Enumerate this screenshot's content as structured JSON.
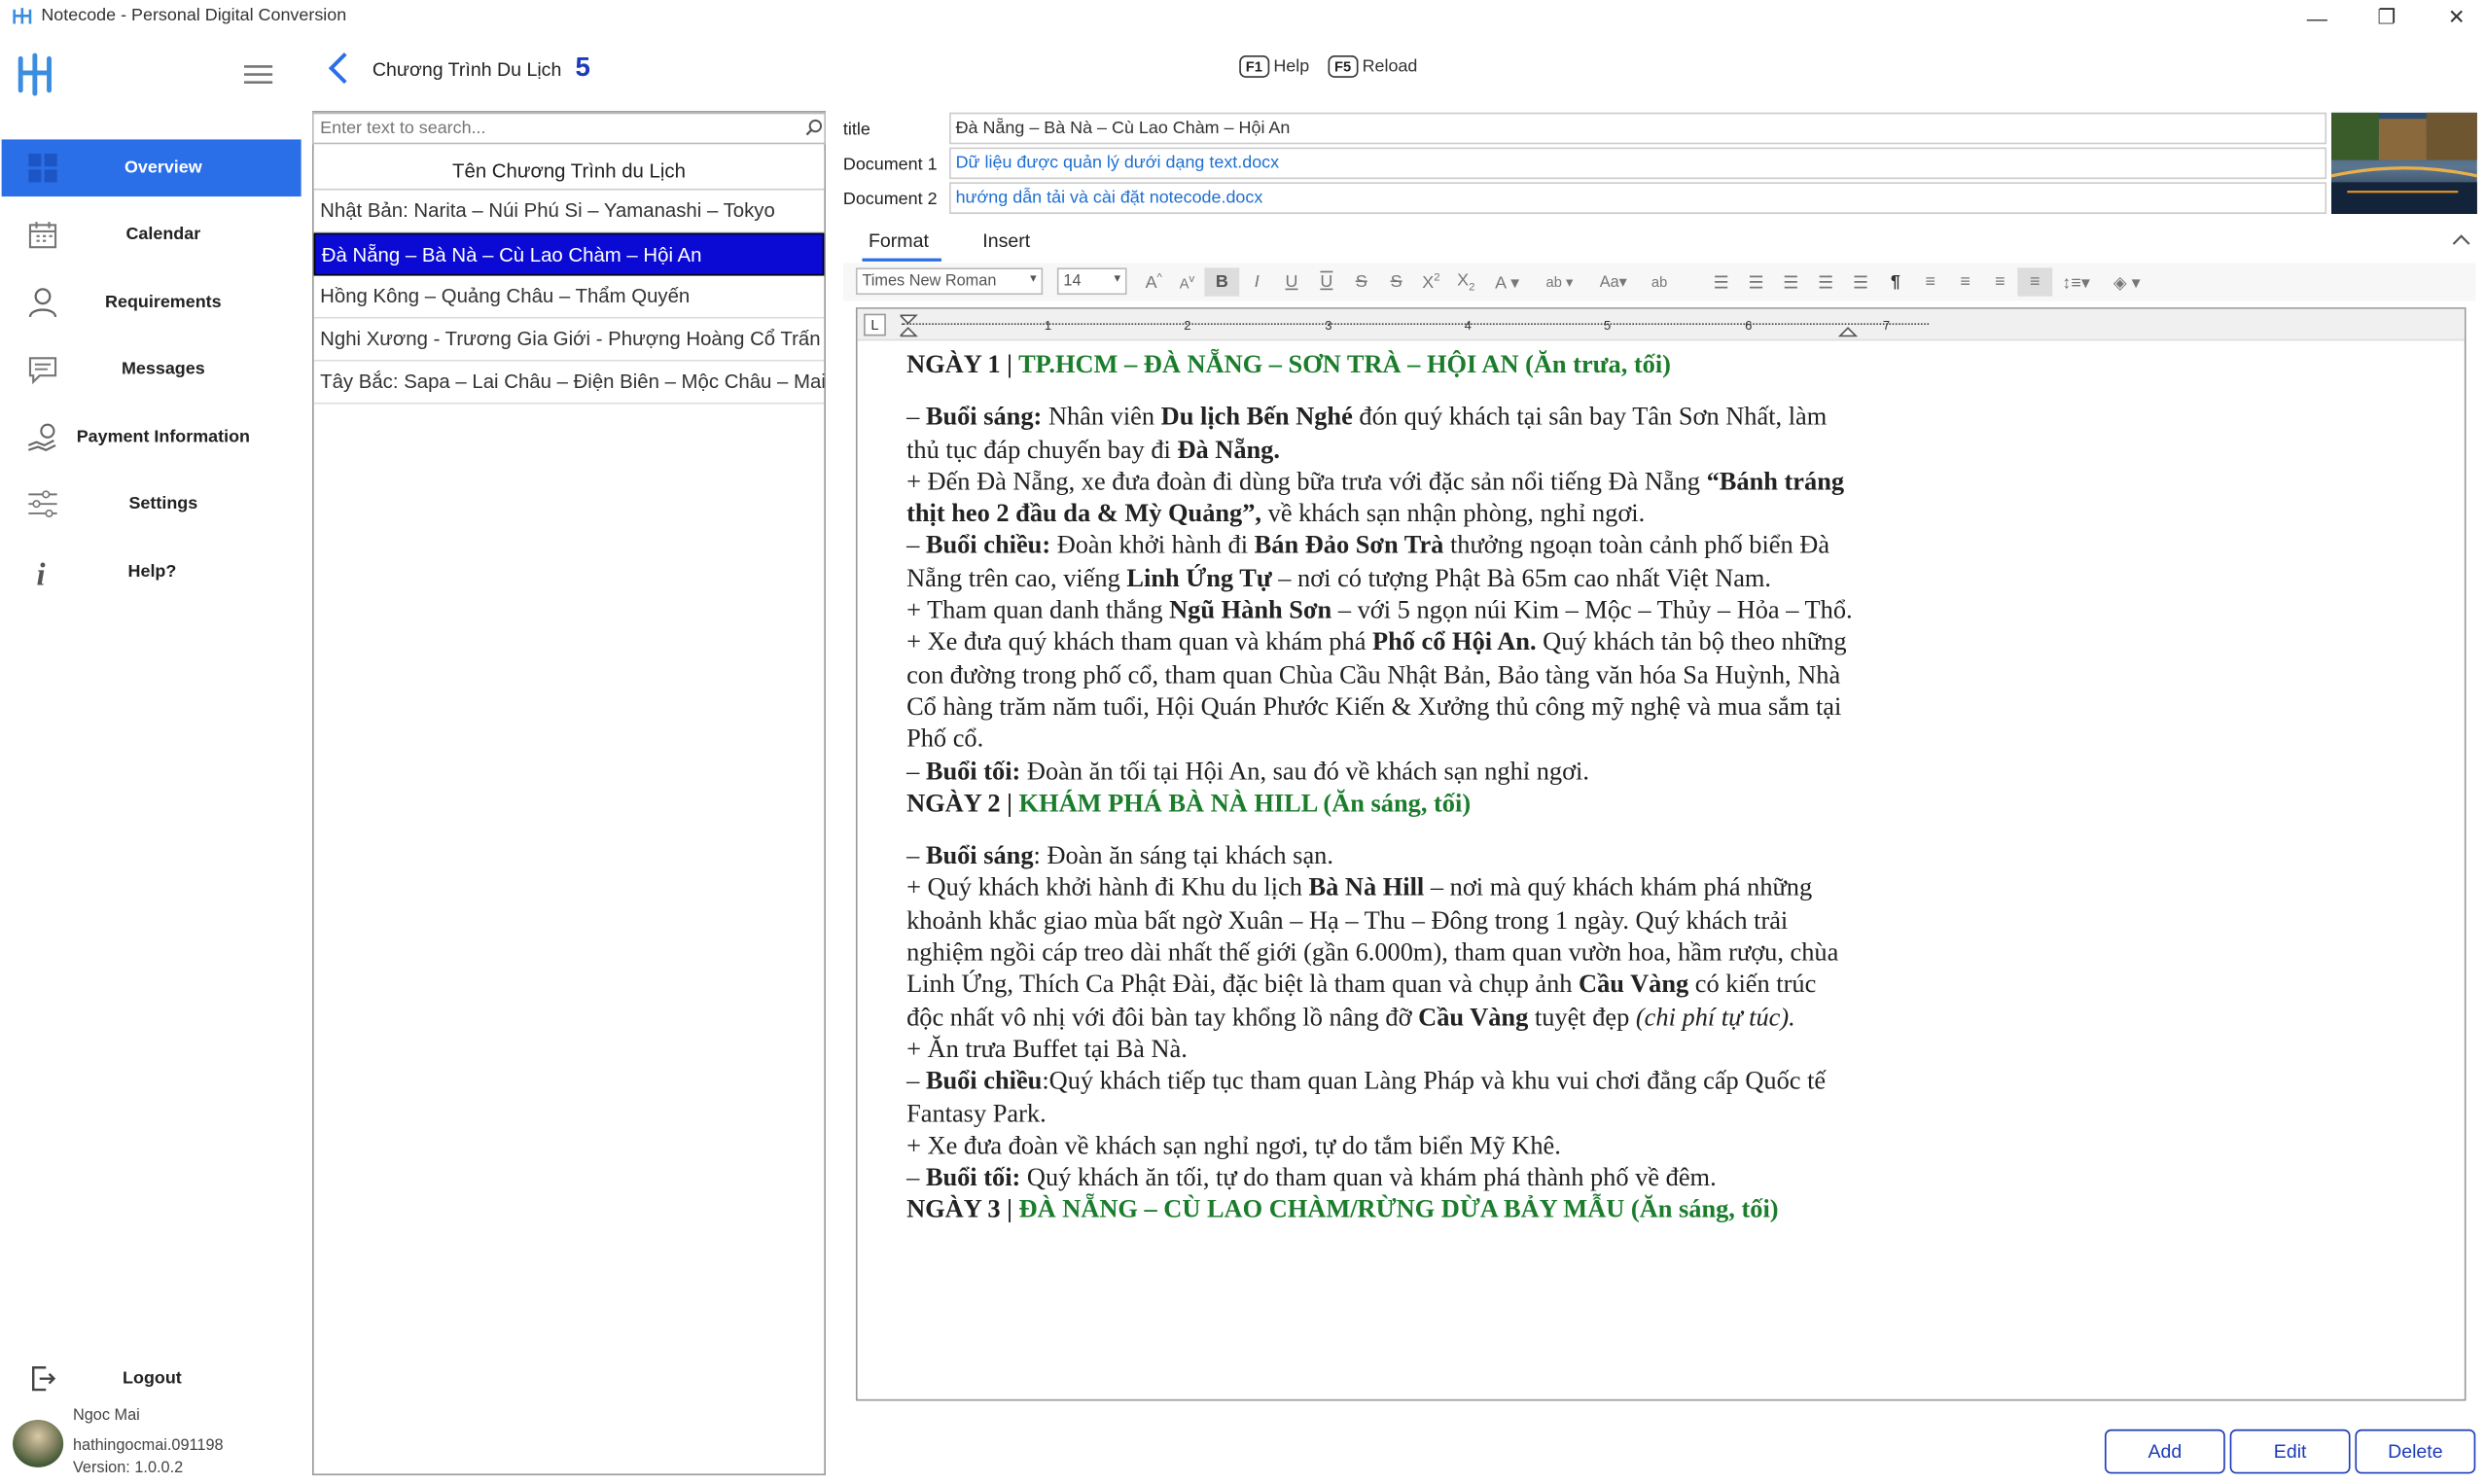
{
  "window": {
    "title": "Notecode - Personal Digital Conversion",
    "minimize": "—",
    "maximize": "❐",
    "close": "✕"
  },
  "sidebar": {
    "items": [
      {
        "label": "Overview",
        "icon": "overview-icon",
        "active": true
      },
      {
        "label": "Calendar",
        "icon": "calendar-icon"
      },
      {
        "label": "Requirements",
        "icon": "user-icon"
      },
      {
        "label": "Messages",
        "icon": "message-icon"
      },
      {
        "label": "Payment Information",
        "icon": "payment-icon"
      },
      {
        "label": "Settings",
        "icon": "sliders-icon"
      },
      {
        "label": "Help?",
        "icon": "info-icon"
      }
    ],
    "logout_label": "Logout",
    "user_name": "Ngoc Mai",
    "user_handle": "hathingocmai.091198",
    "version": "Version: 1.0.0.2"
  },
  "header": {
    "title": "Chương Trình Du Lịch",
    "count": "5",
    "help_key": "F1",
    "help_label": "Help",
    "reload_key": "F5",
    "reload_label": "Reload"
  },
  "list": {
    "search_placeholder": "Enter text to search...",
    "column_header": "Tên Chương Trình du Lịch",
    "rows": [
      "Nhật Bản: Narita – Núi Phú Si – Yamanashi – Tokyo",
      "Đà Nẵng – Bà Nà – Cù Lao Chàm – Hội An",
      "Hồng Kông – Quảng Châu – Thẩm Quyến",
      "Nghi Xương - Trương Gia Giới - Phượng Hoàng Cổ Trấn",
      "Tây Bắc: Sapa – Lai Châu – Điện Biên – Mộc Châu – Mai Châu"
    ],
    "selected_index": 1
  },
  "fields": {
    "title_label": "title",
    "title_value": "Đà Nẵng – Bà Nà – Cù Lao Chàm – Hội An",
    "doc1_label": "Document 1",
    "doc1_value": "Dữ liệu được quản lý dưới dạng text.docx",
    "doc2_label": "Document 2",
    "doc2_value": "hướng dẫn tải và cài đặt notecode.docx"
  },
  "ribbon": {
    "tabs": [
      "Format",
      "Insert"
    ],
    "font_name": "Times New Roman",
    "font_size": "14"
  },
  "document": {
    "day1_prefix": "NGÀY 1 | ",
    "day1_title": "TP.HCM – ĐÀ NẴNG – SƠN TRÀ – HỘI AN (Ăn trưa, tối)",
    "d1p1a": "– ",
    "d1p1b": "Buổi sáng:",
    "d1p1c": " Nhân viên ",
    "d1p1d": "Du lịch Bến Nghé",
    "d1p1e": " đón quý khách tại sân bay Tân Sơn Nhất, làm thủ tục đáp chuyến bay đi ",
    "d1p1f": "Đà Nẵng.",
    "d1p2a": "+ Đến Đà Nẵng, xe đưa đoàn đi dùng bữa trưa với đặc sản nổi tiếng Đà Nẵng ",
    "d1p2b": "“Bánh tráng thịt heo 2 đầu da & Mỳ Quảng”,",
    "d1p2c": " về khách sạn nhận phòng, nghỉ ngơi.",
    "d1p3a": "– ",
    "d1p3b": "Buổi chiều:",
    "d1p3c": " Đoàn khởi hành đi ",
    "d1p3d": "Bán Đảo Sơn Trà",
    "d1p3e": " thưởng ngoạn toàn cảnh phố biển Đà Nẵng trên cao, viếng ",
    "d1p3f": "Linh Ứng Tự",
    "d1p3g": " – nơi có tượng Phật Bà 65m cao nhất Việt Nam.",
    "d1p4a": "+ Tham quan danh thắng ",
    "d1p4b": "Ngũ Hành Sơn",
    "d1p4c": " – với 5 ngọn núi Kim – Mộc – Thủy – Hỏa – Thổ.",
    "d1p5a": "+ Xe đưa quý khách tham quan và khám phá ",
    "d1p5b": "Phố cổ Hội An.",
    "d1p5c": " Quý khách tản bộ theo những con đường trong phố cổ, tham quan Chùa Cầu Nhật Bản, Bảo tàng văn hóa Sa Huỳnh, Nhà Cổ hàng trăm năm tuổi, Hội Quán Phước Kiến & Xưởng thủ công mỹ nghệ và mua sắm tại Phố cổ.",
    "d1p6a": "– ",
    "d1p6b": "Buổi tối:",
    "d1p6c": " Đoàn ăn tối tại Hội An, sau đó về khách sạn nghỉ ngơi.",
    "day2_prefix": "NGÀY 2 | ",
    "day2_title": "KHÁM PHÁ BÀ NÀ HILL (Ăn sáng, tối)",
    "d2p1a": "– ",
    "d2p1b": "Buổi sáng",
    "d2p1c": ": Đoàn ăn sáng tại khách sạn.",
    "d2p2a": "+ Quý khách khởi hành đi Khu du lịch ",
    "d2p2b": "Bà Nà Hill",
    "d2p2c": " – nơi mà quý khách khám phá những khoảnh khắc giao mùa bất ngờ Xuân – Hạ – Thu – Đông trong 1 ngày. Quý khách trải nghiệm ngồi cáp treo dài nhất thế giới (gần 6.000m), tham quan vườn hoa, hầm rượu, chùa Linh Ứng, Thích Ca Phật Đài, đặc biệt là tham quan và chụp ảnh ",
    "d2p2d": "Cầu Vàng",
    "d2p2e": " có kiến trúc độc nhất vô nhị với đôi bàn tay khổng lồ nâng đỡ ",
    "d2p2f": "Cầu Vàng",
    "d2p2g": " tuyệt đẹp ",
    "d2p2h": "(chi phí tự túc).",
    "d2p3": "+ Ăn trưa Buffet tại Bà Nà.",
    "d2p4a": "– ",
    "d2p4b": "Buổi chiều",
    "d2p4c": ":Quý khách tiếp tục tham quan Làng Pháp và khu vui chơi đẳng cấp Quốc tế Fantasy Park.",
    "d2p5": "+ Xe đưa đoàn về khách sạn nghỉ ngơi, tự do tắm biển Mỹ Khê.",
    "d2p6a": "– ",
    "d2p6b": "Buổi tối:",
    "d2p6c": " Quý khách ăn tối, tự do tham quan và khám phá thành phố về đêm.",
    "day3_prefix": "NGÀY 3 | ",
    "day3_title": "ĐÀ NẴNG – CÙ LAO CHÀM/RỪNG DỪA BẢY MẪU (Ăn sáng, tối)"
  },
  "buttons": {
    "add": "Add",
    "edit": "Edit",
    "delete": "Delete"
  },
  "colors": {
    "accent": "#2a6ee8",
    "selected_row": "#0a0ad4",
    "doc_green": "#1b7d2c",
    "button_border": "#1c3bb8"
  }
}
